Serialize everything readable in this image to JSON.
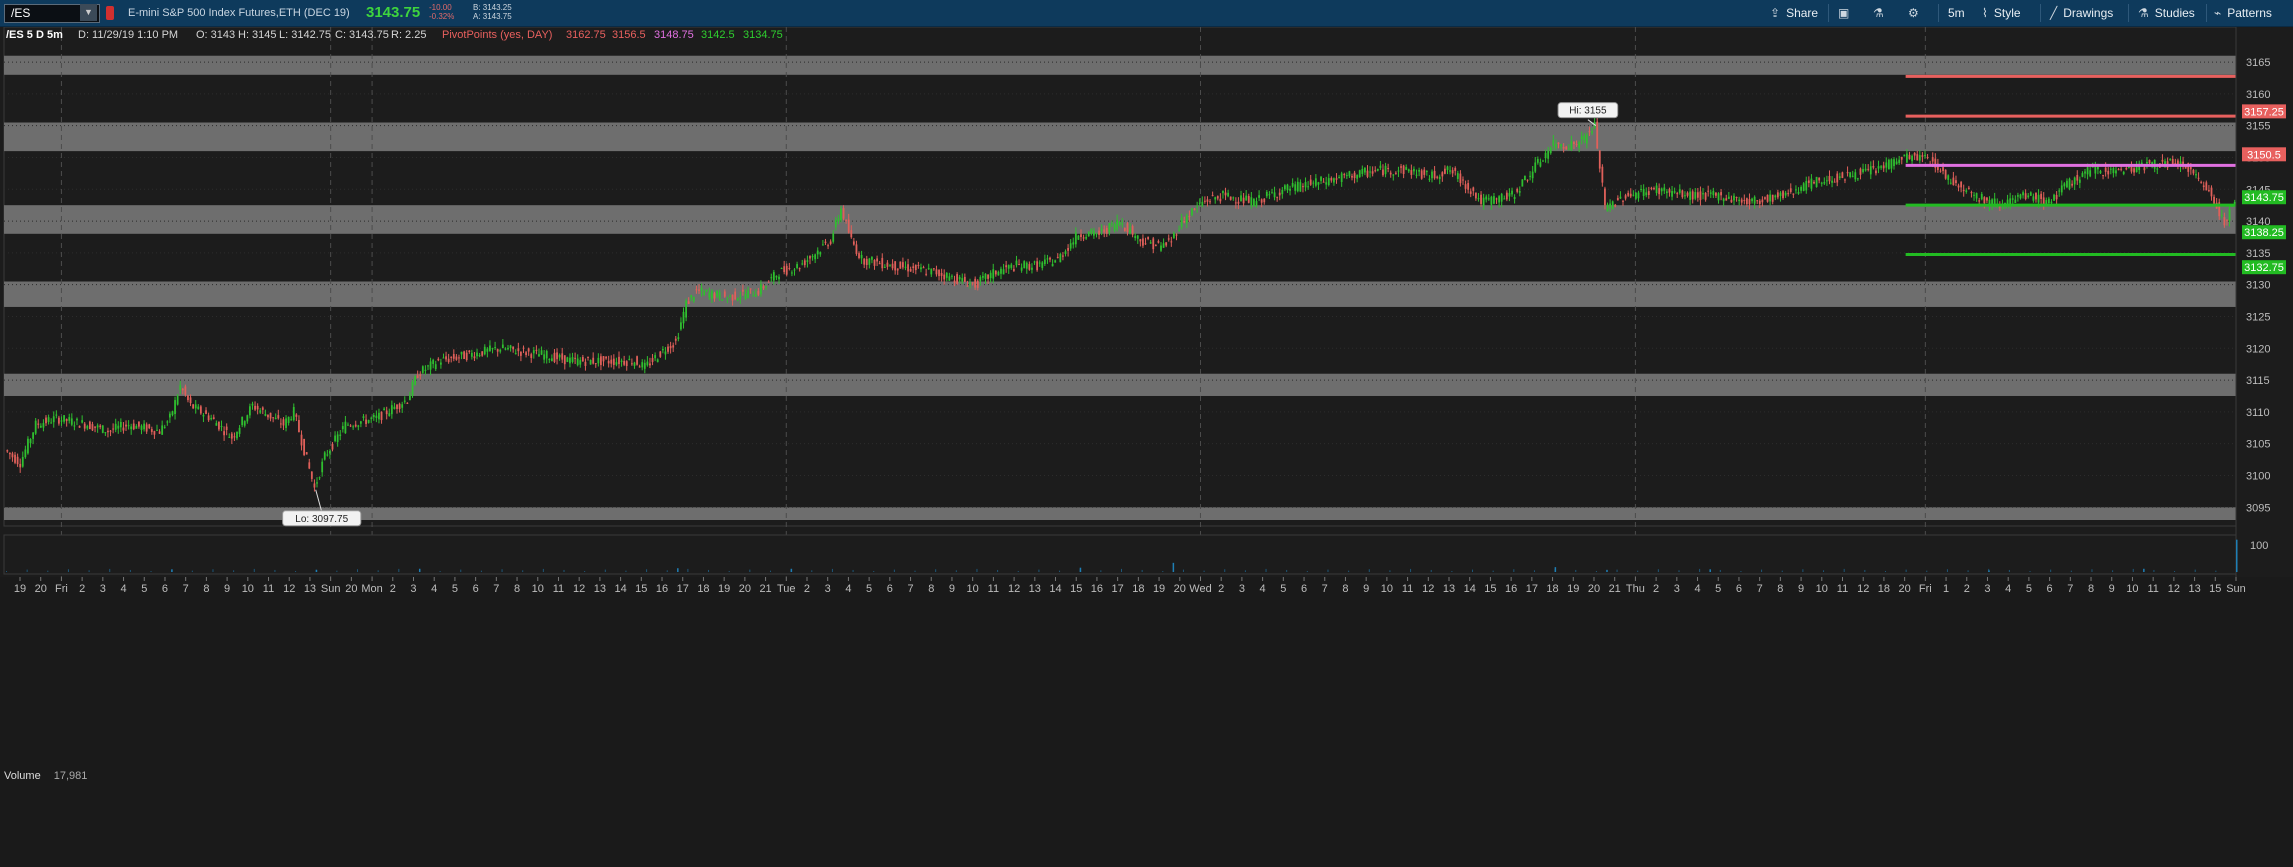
{
  "toolbar": {
    "symbol": "/ES",
    "instrument_name": "E-mini S&P 500 Index Futures,ETH (DEC 19)",
    "last_price": "3143.75",
    "change": "-10.00",
    "change_pct": "-0.32%",
    "bid": "B: 3143.25",
    "ask": "A: 3143.75",
    "share_label": "Share",
    "timeframe_label": "5m",
    "style_label": "Style",
    "drawings_label": "Drawings",
    "studies_label": "Studies",
    "patterns_label": "Patterns"
  },
  "infobar": {
    "chart_label": "/ES 5 D 5m",
    "date": "D: 11/29/19 1:10 PM",
    "open": "O: 3143",
    "high": "H: 3145",
    "low": "L: 3142.75",
    "close": "C: 3143.75",
    "range": "R: 2.25",
    "pivot_title": "PivotPoints (yes, DAY)",
    "pivot_r2": "3162.75",
    "pivot_r1": "3156.5",
    "pivot_pp": "3148.75",
    "pivot_s1": "3142.5",
    "pivot_s2": "3134.75"
  },
  "colors": {
    "toolbar_bg": "#0e3a5c",
    "chart_bg": "#1c1c1c",
    "zone": "#6e6e6e",
    "candle_up": "#2fbf2f",
    "candle_down": "#e0605a",
    "resistance": "#e8605e",
    "pivot": "#e070e0",
    "support": "#22bb22",
    "volume": "#1f7fb5"
  },
  "chart_data": {
    "type": "candlestick",
    "price_axis": {
      "min": 3093,
      "max": 3168,
      "ticks": [
        3095,
        3100,
        3105,
        3110,
        3115,
        3120,
        3125,
        3130,
        3135,
        3140,
        3145,
        3150,
        3155,
        3160,
        3165
      ]
    },
    "zones": [
      [
        3163,
        3166
      ],
      [
        3151,
        3155.5
      ],
      [
        3138,
        3142.5
      ],
      [
        3126.5,
        3130.5
      ],
      [
        3112.5,
        3116
      ],
      [
        3093,
        3095
      ]
    ],
    "time_ticks": [
      "19",
      "20",
      "Fri",
      "2",
      "3",
      "4",
      "5",
      "6",
      "7",
      "8",
      "9",
      "10",
      "11",
      "12",
      "13",
      "Sun",
      "20",
      "Mon",
      "2",
      "3",
      "4",
      "5",
      "6",
      "7",
      "8",
      "10",
      "11",
      "12",
      "13",
      "14",
      "15",
      "16",
      "17",
      "18",
      "19",
      "20",
      "21",
      "Tue",
      "2",
      "3",
      "4",
      "5",
      "6",
      "7",
      "8",
      "9",
      "10",
      "11",
      "12",
      "13",
      "14",
      "15",
      "16",
      "17",
      "18",
      "19",
      "20",
      "Wed",
      "2",
      "3",
      "4",
      "5",
      "6",
      "7",
      "8",
      "9",
      "10",
      "11",
      "12",
      "13",
      "14",
      "15",
      "16",
      "17",
      "18",
      "19",
      "20",
      "21",
      "Thu",
      "2",
      "3",
      "4",
      "5",
      "6",
      "7",
      "8",
      "9",
      "10",
      "11",
      "12",
      "18",
      "20",
      "Fri",
      "1",
      "2",
      "3",
      "4",
      "5",
      "6",
      "7",
      "8",
      "9",
      "10",
      "11",
      "12",
      "13",
      "15",
      "Sun"
    ],
    "session_breaks": [
      "Sun",
      "Mon",
      "Tue",
      "Wed",
      "Thu",
      "Fri"
    ],
    "price_path": [
      [
        0,
        3104
      ],
      [
        1.5,
        3102
      ],
      [
        3,
        3108
      ],
      [
        5,
        3109
      ],
      [
        8,
        3108
      ],
      [
        10,
        3107
      ],
      [
        12,
        3108
      ],
      [
        15,
        3107
      ],
      [
        16,
        3109
      ],
      [
        17,
        3114
      ],
      [
        18,
        3111
      ],
      [
        20,
        3109
      ],
      [
        22,
        3106
      ],
      [
        24,
        3111
      ],
      [
        27,
        3108
      ],
      [
        28,
        3110
      ],
      [
        29,
        3104
      ],
      [
        30,
        3098
      ],
      [
        31,
        3103
      ],
      [
        33,
        3108
      ],
      [
        36,
        3109
      ],
      [
        38,
        3111
      ],
      [
        39,
        3112
      ],
      [
        40,
        3116
      ],
      [
        42,
        3118
      ],
      [
        45,
        3119
      ],
      [
        48,
        3120
      ],
      [
        52,
        3119
      ],
      [
        55,
        3118
      ],
      [
        58,
        3118
      ],
      [
        61,
        3118
      ],
      [
        62,
        3117
      ],
      [
        64,
        3120
      ],
      [
        65,
        3121
      ],
      [
        66,
        3127
      ],
      [
        67,
        3129
      ],
      [
        70,
        3128
      ],
      [
        73,
        3129
      ],
      [
        75,
        3132
      ],
      [
        77,
        3133
      ],
      [
        80,
        3137
      ],
      [
        81,
        3142
      ],
      [
        82,
        3137
      ],
      [
        83,
        3134
      ],
      [
        86,
        3133
      ],
      [
        90,
        3132
      ],
      [
        92,
        3131
      ],
      [
        94,
        3130
      ],
      [
        96,
        3132
      ],
      [
        98,
        3133
      ],
      [
        100,
        3133
      ],
      [
        102,
        3134
      ],
      [
        104,
        3138
      ],
      [
        106,
        3138
      ],
      [
        108,
        3140
      ],
      [
        110,
        3137
      ],
      [
        112,
        3136
      ],
      [
        113,
        3137
      ],
      [
        114,
        3140
      ],
      [
        116,
        3143
      ],
      [
        118,
        3144
      ],
      [
        121,
        3143
      ],
      [
        124,
        3145
      ],
      [
        127,
        3146
      ],
      [
        130,
        3147
      ],
      [
        133,
        3148
      ],
      [
        136,
        3148
      ],
      [
        138,
        3147
      ],
      [
        140,
        3148
      ],
      [
        142,
        3145
      ],
      [
        143,
        3143
      ],
      [
        146,
        3144
      ],
      [
        148,
        3148
      ],
      [
        150,
        3152
      ],
      [
        152,
        3152
      ],
      [
        153,
        3153
      ],
      [
        154,
        3155
      ],
      [
        155,
        3142
      ],
      [
        157,
        3144
      ],
      [
        160,
        3145
      ],
      [
        163,
        3144
      ],
      [
        166,
        3144
      ],
      [
        169,
        3143
      ],
      [
        172,
        3144
      ],
      [
        175,
        3146
      ],
      [
        178,
        3147
      ],
      [
        181,
        3148
      ],
      [
        184,
        3150
      ],
      [
        186,
        3150
      ],
      [
        187,
        3149
      ],
      [
        188,
        3147
      ],
      [
        190,
        3145
      ],
      [
        192,
        3143
      ],
      [
        194,
        3143
      ],
      [
        196,
        3144
      ],
      [
        198,
        3143
      ],
      [
        200,
        3146
      ],
      [
        202,
        3148
      ],
      [
        205,
        3148
      ],
      [
        208,
        3149
      ],
      [
        211,
        3149
      ],
      [
        212,
        3147
      ],
      [
        213,
        3146
      ],
      [
        214,
        3143
      ],
      [
        215,
        3140
      ],
      [
        216,
        3143
      ]
    ],
    "bar_count": 216,
    "hi_label": "Hi: 3155",
    "lo_label": "Lo: 3097.75",
    "hi_point": [
      154,
      3155
    ],
    "lo_point": [
      30,
      3097.75
    ],
    "pivot_lines": [
      {
        "name": "R2",
        "value": 3162.75,
        "color": "#e8605e"
      },
      {
        "name": "R1",
        "value": 3156.5,
        "color": "#e8605e"
      },
      {
        "name": "PP",
        "value": 3148.75,
        "color": "#e070e0"
      },
      {
        "name": "S1",
        "value": 3142.5,
        "color": "#22bb22"
      },
      {
        "name": "S2",
        "value": 3134.75,
        "color": "#22bb22"
      }
    ],
    "pivot_start_bar": 184,
    "price_tags": [
      {
        "text": "3157.25",
        "value": 3157.25,
        "bg": "#e8605e"
      },
      {
        "text": "3150.5",
        "value": 3150.5,
        "bg": "#e8605e"
      },
      {
        "text": "3143.75",
        "value": 3143.75,
        "bg": "#22bb22"
      },
      {
        "text": "3138.25",
        "value": 3138.25,
        "bg": "#22bb22"
      },
      {
        "text": "3132.75",
        "value": 3132.75,
        "bg": "#22bb22"
      }
    ],
    "volume": {
      "label": "Volume",
      "value": "17,981",
      "axis_tick": "100",
      "axis_max": 130,
      "spikes": [
        [
          16,
          10
        ],
        [
          30,
          8
        ],
        [
          40,
          12
        ],
        [
          65,
          14
        ],
        [
          76,
          12
        ],
        [
          104,
          16
        ],
        [
          113,
          34
        ],
        [
          150,
          18
        ],
        [
          155,
          8
        ],
        [
          165,
          10
        ],
        [
          192,
          6
        ],
        [
          207,
          12
        ],
        [
          216,
          120
        ]
      ]
    }
  }
}
